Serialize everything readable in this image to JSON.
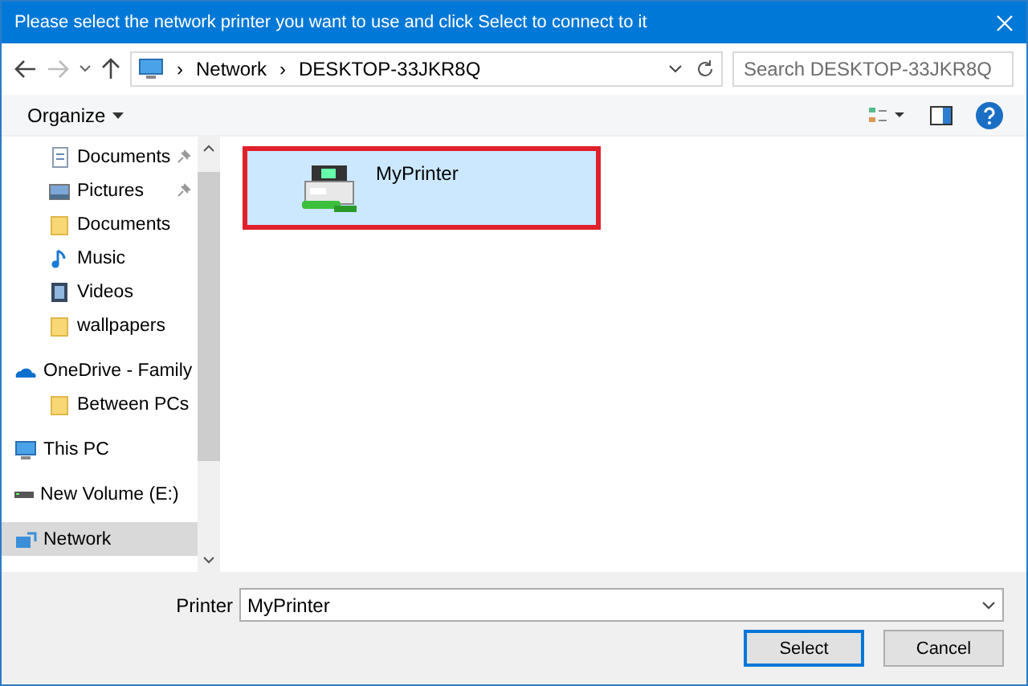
{
  "window": {
    "title": "Please select the network printer you want to use and click Select to connect to it"
  },
  "address_bar": {
    "separator": "›",
    "path": [
      "Network",
      "DESKTOP-33JKR8Q"
    ]
  },
  "search": {
    "placeholder": "Search DESKTOP-33JKR8Q"
  },
  "toolbar": {
    "organize": "Organize"
  },
  "sidebar": {
    "items": [
      {
        "label": "Documents",
        "kind": "doc",
        "pinned": true,
        "selected": false,
        "indent": true
      },
      {
        "label": "Pictures",
        "kind": "pictures",
        "pinned": true,
        "selected": false,
        "indent": true
      },
      {
        "label": "Documents",
        "kind": "folder",
        "pinned": false,
        "selected": false,
        "indent": true
      },
      {
        "label": "Music",
        "kind": "music",
        "pinned": false,
        "selected": false,
        "indent": true
      },
      {
        "label": "Videos",
        "kind": "videos",
        "pinned": false,
        "selected": false,
        "indent": true
      },
      {
        "label": "wallpapers",
        "kind": "folder",
        "pinned": false,
        "selected": false,
        "indent": true
      },
      {
        "label": "OneDrive - Family",
        "kind": "cloud",
        "pinned": false,
        "selected": false,
        "indent": false
      },
      {
        "label": "Between PCs",
        "kind": "folder",
        "pinned": false,
        "selected": false,
        "indent": true
      },
      {
        "label": "This PC",
        "kind": "pc",
        "pinned": false,
        "selected": false,
        "indent": false
      },
      {
        "label": "New Volume (E:)",
        "kind": "drive",
        "pinned": false,
        "selected": false,
        "indent": false
      },
      {
        "label": "Network",
        "kind": "network",
        "pinned": false,
        "selected": true,
        "indent": false
      }
    ]
  },
  "items": [
    {
      "label": "MyPrinter",
      "selected": true
    }
  ],
  "footer": {
    "field_label": "Printer",
    "value": "MyPrinter",
    "buttons": [
      {
        "label": "Select",
        "default": true
      },
      {
        "label": "Cancel",
        "default": false
      }
    ]
  }
}
